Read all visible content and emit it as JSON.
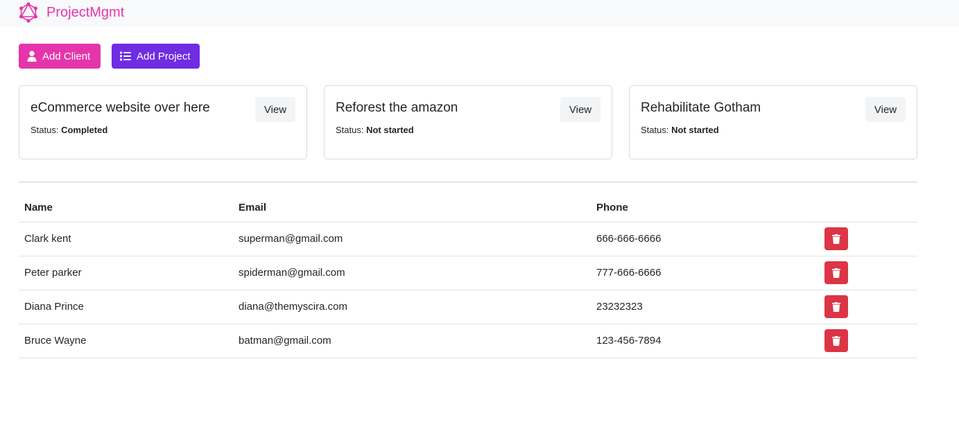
{
  "navbar": {
    "brand": "ProjectMgmt",
    "logo_icon": "graphql-logo-icon",
    "brand_color": "#e535ab"
  },
  "actions": {
    "add_client_label": "Add Client",
    "add_project_label": "Add Project",
    "add_client_color": "#e535ab",
    "add_project_color": "#6f2ce3"
  },
  "projects": [
    {
      "name": "eCommerce website over here",
      "status_label": "Status:",
      "status": "Completed",
      "view_label": "View"
    },
    {
      "name": "Reforest the amazon",
      "status_label": "Status:",
      "status": "Not started",
      "view_label": "View"
    },
    {
      "name": "Rehabilitate Gotham",
      "status_label": "Status:",
      "status": "Not started",
      "view_label": "View"
    }
  ],
  "clients": {
    "headers": {
      "name": "Name",
      "email": "Email",
      "phone": "Phone"
    },
    "delete_icon": "trash-icon",
    "delete_color": "#dc3545",
    "rows": [
      {
        "name": "Clark kent",
        "email": "superman@gmail.com",
        "phone": "666-666-6666"
      },
      {
        "name": "Peter parker",
        "email": "spiderman@gmail.com",
        "phone": "777-666-6666"
      },
      {
        "name": "Diana Prince",
        "email": "diana@themyscira.com",
        "phone": "23232323"
      },
      {
        "name": "Bruce Wayne",
        "email": "batman@gmail.com",
        "phone": "123-456-7894"
      }
    ]
  }
}
